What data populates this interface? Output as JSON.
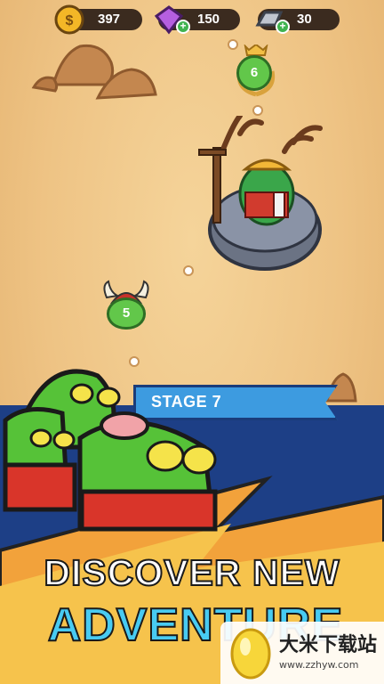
{
  "resources": {
    "coins": "397",
    "gems": "150",
    "metal": "30"
  },
  "map": {
    "node_upper": "6",
    "node_lower": "5"
  },
  "stage": {
    "label": "STAGE 7"
  },
  "promo": {
    "line1": "DISCOVER NEW",
    "line2": "ADVENTURE"
  },
  "watermark": {
    "title": "大米下载站",
    "url": "www.zzhyw.com"
  },
  "colors": {
    "sand": "#f0c98c",
    "band": "#1d3f86",
    "banner": "#3d9be0",
    "node": "#62c74a",
    "title_cyan": "#48cbf2"
  }
}
